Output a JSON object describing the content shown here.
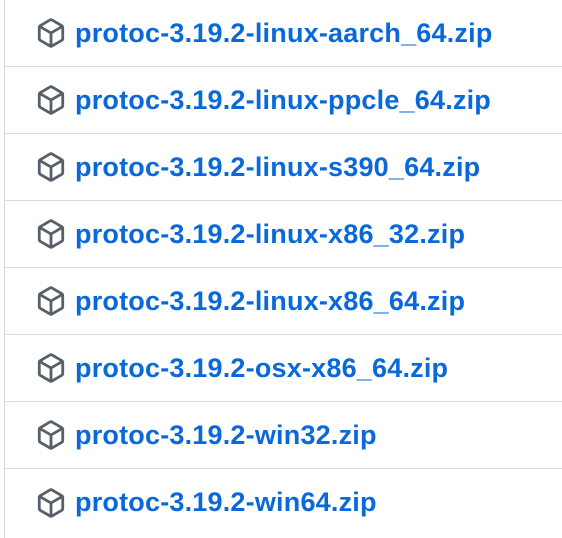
{
  "assets": {
    "items": [
      {
        "name": "protoc-3.19.2-linux-aarch_64.zip",
        "icon": "package-icon"
      },
      {
        "name": "protoc-3.19.2-linux-ppcle_64.zip",
        "icon": "package-icon"
      },
      {
        "name": "protoc-3.19.2-linux-s390_64.zip",
        "icon": "package-icon"
      },
      {
        "name": "protoc-3.19.2-linux-x86_32.zip",
        "icon": "package-icon"
      },
      {
        "name": "protoc-3.19.2-linux-x86_64.zip",
        "icon": "package-icon"
      },
      {
        "name": "protoc-3.19.2-osx-x86_64.zip",
        "icon": "package-icon"
      },
      {
        "name": "protoc-3.19.2-win32.zip",
        "icon": "package-icon"
      },
      {
        "name": "protoc-3.19.2-win64.zip",
        "icon": "package-icon"
      }
    ]
  },
  "colors": {
    "link": "#0969da",
    "icon": "#57606a",
    "divider": "#d8dee4"
  }
}
